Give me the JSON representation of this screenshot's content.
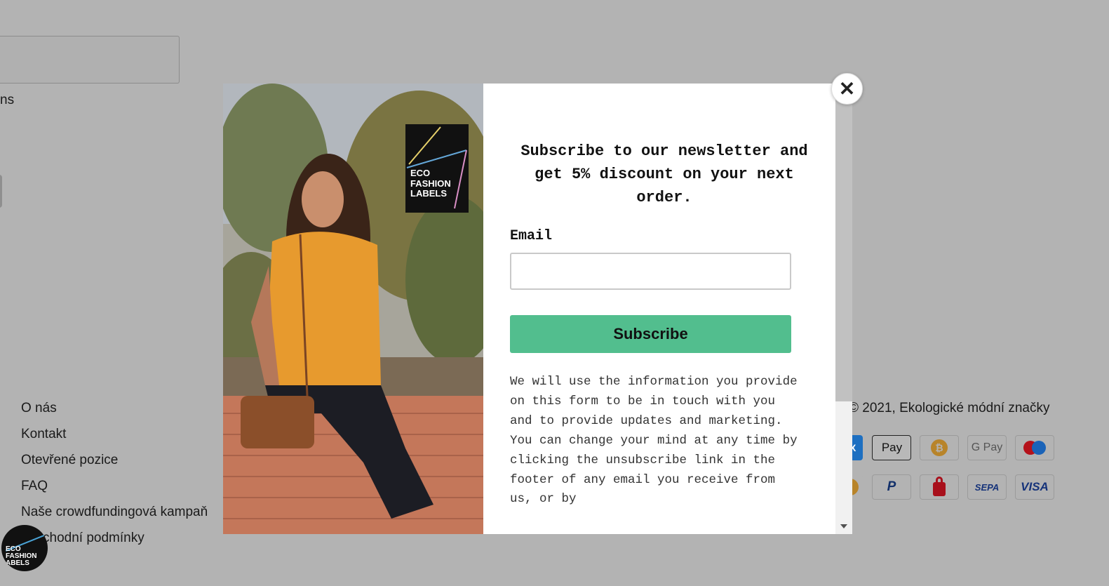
{
  "background": {
    "partial_text": "ns",
    "footer_links": [
      "O nás",
      "Kontakt",
      "Otevřené pozice",
      "FAQ",
      "Naše crowdfundingová kampaň",
      "chodní podmínky"
    ],
    "copyright": "2021, Ekologické módní značky",
    "logo_text": [
      "ECO",
      "FASHION",
      "ABELS"
    ],
    "payments": {
      "row1": [
        {
          "name": "apple-pay",
          "label": "Pay"
        },
        {
          "name": "bitcoin",
          "label": "₿"
        },
        {
          "name": "google-pay",
          "label": "G Pay"
        },
        {
          "name": "maestro",
          "label": ""
        }
      ],
      "row2": [
        {
          "name": "paypal",
          "label": "P"
        },
        {
          "name": "secure-lock",
          "label": ""
        },
        {
          "name": "sepa",
          "label": "SEPA"
        },
        {
          "name": "visa",
          "label": "VISA"
        }
      ]
    }
  },
  "modal": {
    "photo_logo": [
      "ECO",
      "FASHION",
      "LABELS"
    ],
    "heading": "Subscribe to our newsletter and get 5% discount on your next order.",
    "email_label": "Email",
    "email_value": "",
    "email_placeholder": "",
    "subscribe_label": "Subscribe",
    "disclaimer": "We will use the information you provide on this form to be in touch with you and to provide updates and marketing. You can change your mind at any time by clicking the unsubscribe link in the footer of any email you receive from us, or by",
    "close_label": "✕"
  },
  "colors": {
    "overlay": "#b3b3b3",
    "subscribe_button": "#52be8e"
  }
}
